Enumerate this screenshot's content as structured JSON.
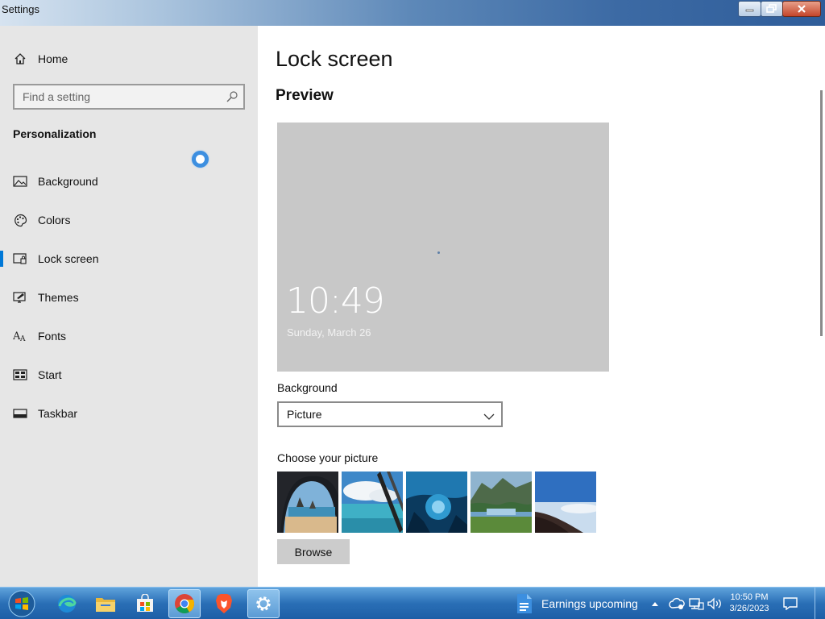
{
  "window": {
    "title": "Settings"
  },
  "sidebar": {
    "home_label": "Home",
    "search_placeholder": "Find a setting",
    "section_title": "Personalization",
    "items": [
      {
        "label": "Background",
        "icon": "picture-icon"
      },
      {
        "label": "Colors",
        "icon": "palette-icon"
      },
      {
        "label": "Lock screen",
        "icon": "lock-screen-icon",
        "active": true
      },
      {
        "label": "Themes",
        "icon": "themes-icon"
      },
      {
        "label": "Fonts",
        "icon": "fonts-icon"
      },
      {
        "label": "Start",
        "icon": "start-icon"
      },
      {
        "label": "Taskbar",
        "icon": "taskbar-icon"
      }
    ]
  },
  "main": {
    "title": "Lock screen",
    "preview_heading": "Preview",
    "preview": {
      "time": "10:49",
      "date": "Sunday, March 26"
    },
    "background_label": "Background",
    "background_value": "Picture",
    "choose_label": "Choose your picture",
    "browse_label": "Browse"
  },
  "taskbar": {
    "news_text": "Earnings upcoming",
    "clock_time": "10:50 PM",
    "clock_date": "3/26/2023"
  },
  "colors": {
    "accent": "#0078d7",
    "sidebar_bg": "#e6e6e6",
    "preview_bg": "#c8c8c8"
  }
}
